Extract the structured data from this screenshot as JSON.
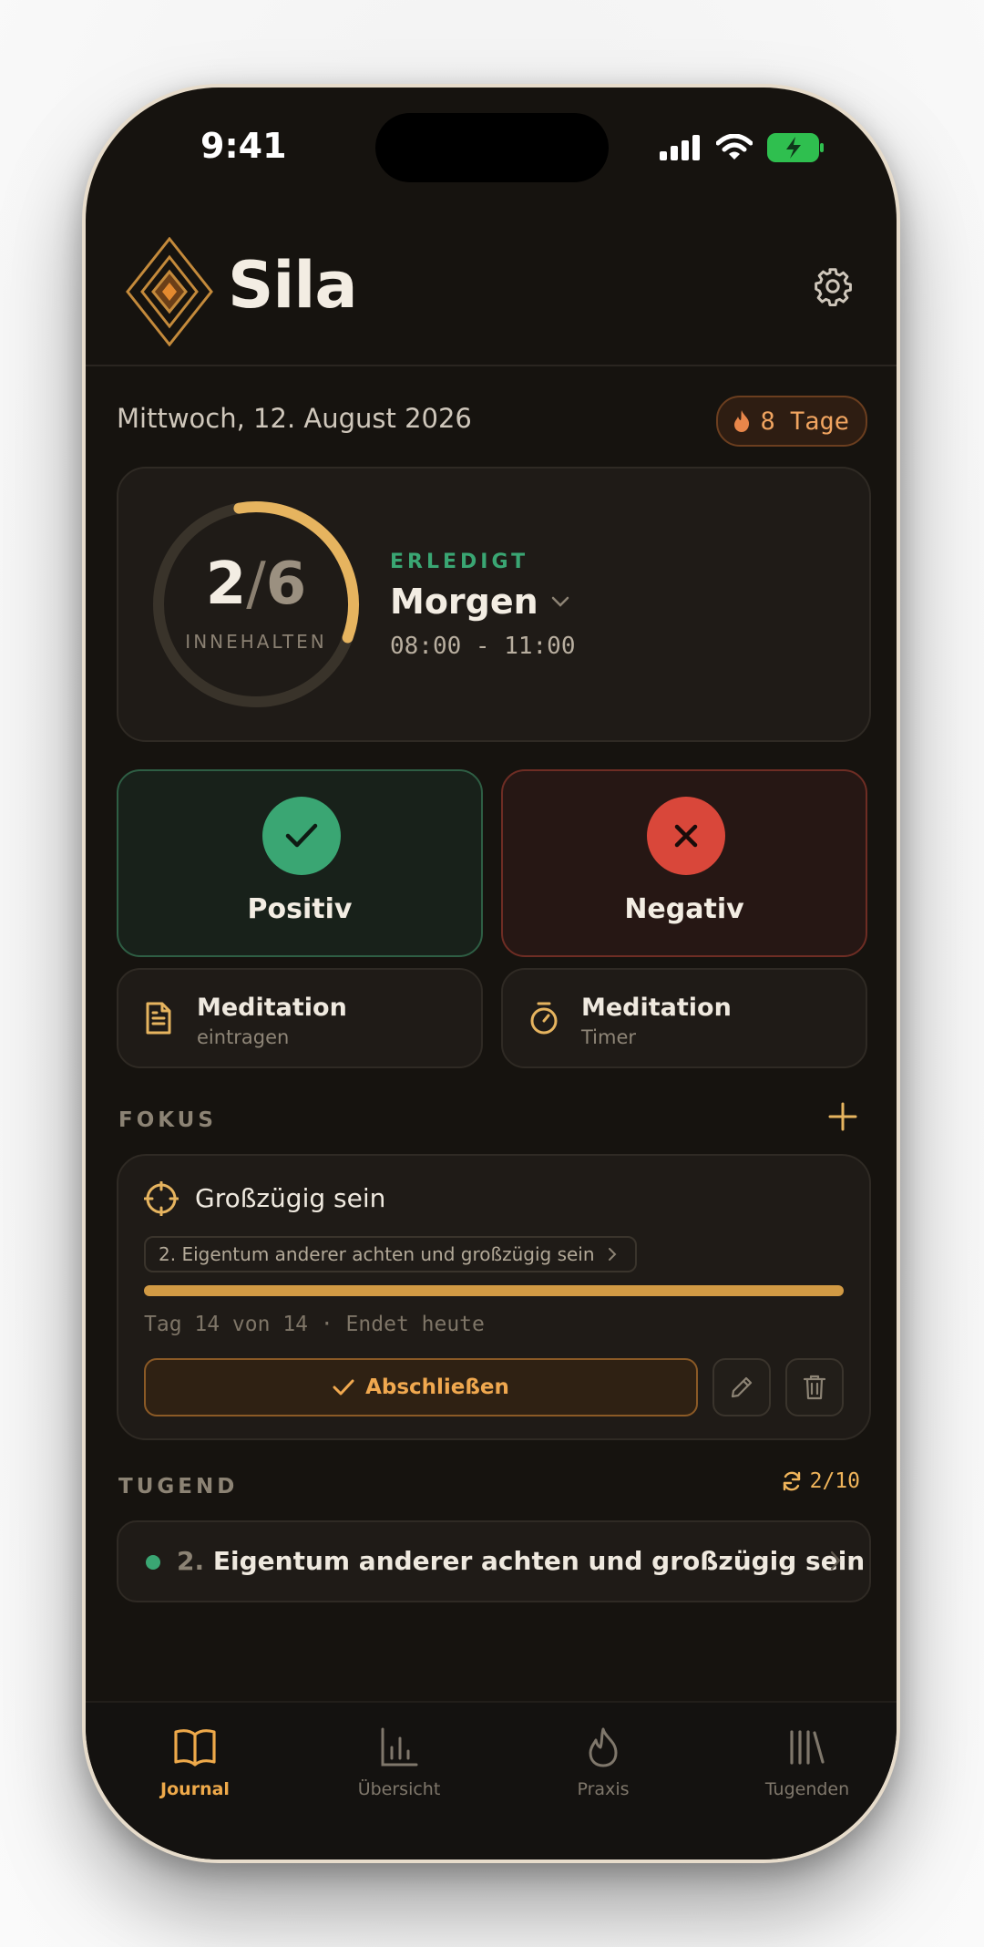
{
  "status_bar": {
    "time": "9:41"
  },
  "header": {
    "title": "Sila"
  },
  "date_label": "Mittwoch, 12. August 2026",
  "streak": {
    "label": "8 Tage"
  },
  "progress": {
    "done": "2",
    "separator": "/",
    "total": "6",
    "ring_label": "INNEHALTEN",
    "status": "ERLEDIGT",
    "session": "Morgen",
    "time_range": "08:00 - 11:00",
    "fraction": 0.333
  },
  "actions": {
    "positive": "Positiv",
    "negative": "Negativ",
    "meditation_log_title": "Meditation",
    "meditation_log_sub": "eintragen",
    "meditation_timer_title": "Meditation",
    "meditation_timer_sub": "Timer"
  },
  "focus": {
    "section": "FOKUS",
    "title": "Großzügig sein",
    "chip": "2. Eigentum anderer achten und großzügig sein",
    "days": "Tag 14 von 14 · Endet heute",
    "progress": 1.0,
    "complete": "Abschließen"
  },
  "virtue": {
    "section": "TUGEND",
    "count": "2/10",
    "number": "2.",
    "text": "Eigentum anderer achten und großzügig sein"
  },
  "tabs": [
    {
      "label": "Journal",
      "icon": "book-icon",
      "active": true
    },
    {
      "label": "Übersicht",
      "icon": "bar-chart-icon",
      "active": false
    },
    {
      "label": "Praxis",
      "icon": "flame-icon",
      "active": false
    },
    {
      "label": "Tugenden",
      "icon": "library-icon",
      "active": false
    }
  ],
  "colors": {
    "background": "#16130f",
    "accent": "#eea94a",
    "positive": "#3aa673",
    "negative": "#d9473a"
  }
}
